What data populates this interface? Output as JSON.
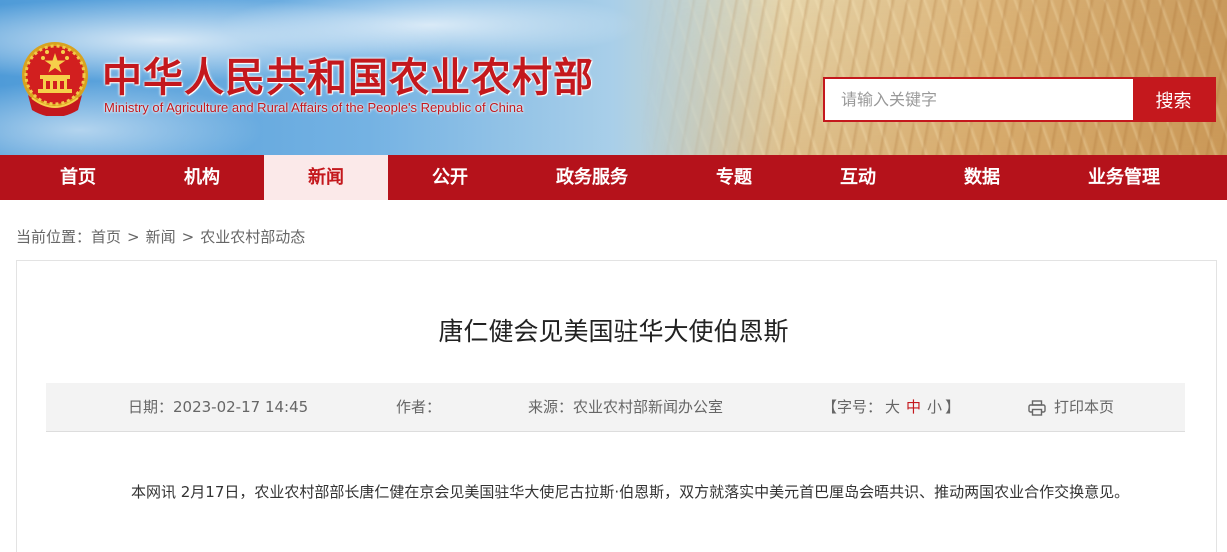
{
  "header": {
    "title": "中华人民共和国农业农村部",
    "subtitle": "Ministry of Agriculture and Rural Affairs of the People's Republic of China",
    "emblem_icon": "national-emblem-icon",
    "search": {
      "placeholder": "请输入关键字",
      "value": "",
      "button_label": "搜索"
    }
  },
  "nav": {
    "items": [
      {
        "label": "首页"
      },
      {
        "label": "机构"
      },
      {
        "label": "新闻",
        "active": true
      },
      {
        "label": "公开"
      },
      {
        "label": "政务服务"
      },
      {
        "label": "专题"
      },
      {
        "label": "互动"
      },
      {
        "label": "数据"
      },
      {
        "label": "业务管理"
      }
    ]
  },
  "breadcrumb": {
    "prefix": "当前位置：",
    "items": [
      "首页",
      "新闻",
      "农业农村部动态"
    ],
    "separator": ">"
  },
  "article": {
    "title": "唐仁健会见美国驻华大使伯恩斯",
    "meta": {
      "date": "日期：2023-02-17 14:45",
      "author": "作者：",
      "source": "来源：农业农村部新闻办公室",
      "font_size": {
        "open": "【字号：",
        "large": "大",
        "medium": "中",
        "small": "小",
        "close": "】",
        "current": "中"
      },
      "print_label": "打印本页",
      "print_icon": "printer-icon"
    },
    "paragraph": "本网讯 2月17日，农业农村部部长唐仁健在京会见美国驻华大使尼古拉斯·伯恩斯，双方就落实中美元首巴厘岛会晤共识、推动两国农业合作交换意见。"
  },
  "colors": {
    "brand_red": "#c4181d",
    "nav_red": "#b5121b",
    "nav_active_bg": "#fbe9e9",
    "meta_bar_bg": "#f3f3f3"
  }
}
